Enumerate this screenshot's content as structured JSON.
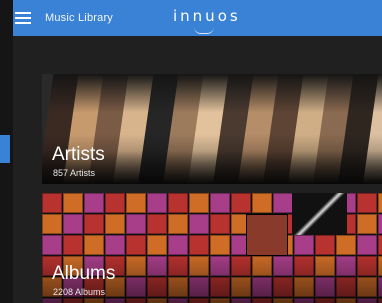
{
  "app": {
    "title": "Music Library",
    "brand": "innuos",
    "accent_color": "#3a82d6"
  },
  "categories": [
    {
      "label": "Artists",
      "count": "857 Artists"
    },
    {
      "label": "Albums",
      "count": "2208 Albums"
    }
  ],
  "icons": {
    "menu": "hamburger-menu-icon"
  }
}
